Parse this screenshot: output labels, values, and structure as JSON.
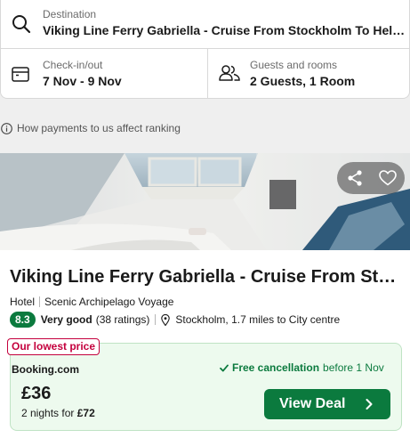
{
  "search": {
    "destination_label": "Destination",
    "destination_value": "Viking Line Ferry Gabriella - Cruise From Stockholm To Helsinki",
    "dates_label": "Check-in/out",
    "dates_value": "7 Nov - 9 Nov",
    "guests_label": "Guests and rooms",
    "guests_value": "2 Guests, 1 Room"
  },
  "info": {
    "text": "How payments to us affect ranking"
  },
  "hotel": {
    "name": "Viking Line Ferry Gabriella - Cruise From Stockholm To Helsinki",
    "type": "Hotel",
    "tagline": "Scenic Archipelago Voyage",
    "rating": "8.3",
    "rating_word": "Very good",
    "rating_count": "(38 ratings)",
    "location": "Stockholm, 1.7 miles to City centre"
  },
  "deal": {
    "tag": "Our lowest price",
    "provider": "Booking.com",
    "free_cancellation": "Free cancellation",
    "cancel_before": "before 1 Nov",
    "price": "£36",
    "nights_text": "2 nights for",
    "total": "£72",
    "button_label": "View Deal"
  },
  "icons": {
    "search": "search-icon",
    "calendar": "calendar-icon",
    "guests": "guests-icon",
    "info": "info-icon",
    "share": "share-icon",
    "favorite": "heart-icon",
    "pin": "location-pin-icon",
    "check": "check-icon",
    "chevron": "chevron-right-icon"
  },
  "colors": {
    "accent_green": "#0b7a3e",
    "deal_bg": "#edfaee",
    "tag_red": "#c4003d"
  }
}
